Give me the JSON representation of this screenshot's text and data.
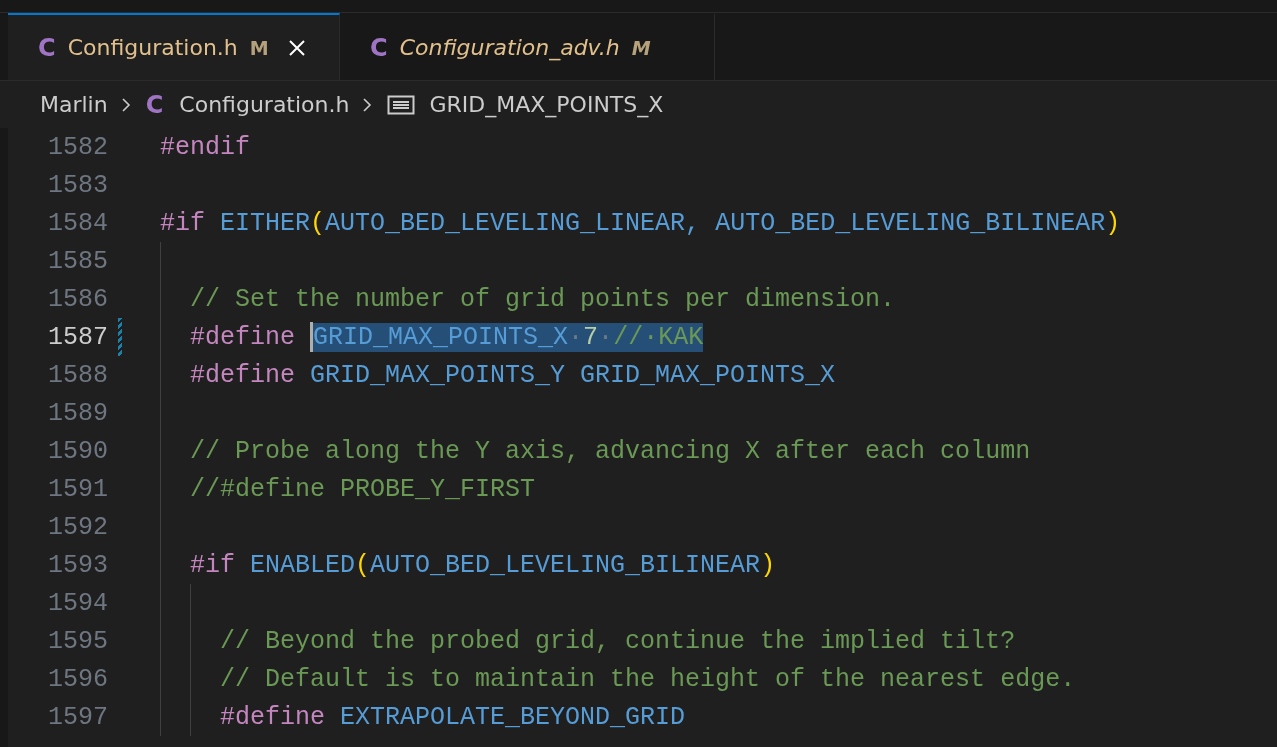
{
  "tabs": [
    {
      "icon": "C",
      "label": "Configuration.h",
      "status": "M",
      "selected": true,
      "preview": false
    },
    {
      "icon": "C",
      "label": "Configuration_adv.h",
      "status": "M",
      "selected": false,
      "preview": true
    }
  ],
  "breadcrumb": [
    {
      "kind": "folder",
      "label": "Marlin"
    },
    {
      "kind": "file",
      "icon": "C",
      "label": "Configuration.h"
    },
    {
      "kind": "symbol",
      "label": "GRID_MAX_POINTS_X"
    }
  ],
  "editor": {
    "lines": [
      {
        "number": "1582",
        "current": false,
        "modified": false,
        "tokens": [
          {
            "kind": "keyword",
            "text": "#endif"
          }
        ]
      },
      {
        "number": "1583",
        "current": false,
        "modified": false
      },
      {
        "number": "1584",
        "current": false,
        "modified": false,
        "tokens": [
          {
            "kind": "keyword",
            "text": "#if"
          },
          {
            "kind": "macro",
            "text": " EITHER"
          },
          {
            "kind": "paren",
            "text": "("
          },
          {
            "kind": "macro",
            "text": "AUTO_BED_LEVELING_LINEAR, AUTO_BED_LEVELING_BILINEAR"
          },
          {
            "kind": "paren",
            "text": ")"
          }
        ],
        "children": [
          {
            "number": "1585",
            "current": false,
            "modified": false
          },
          {
            "number": "1586",
            "current": false,
            "modified": false,
            "tokens": [
              {
                "kind": "comment",
                "text": "// Set the number of grid points per dimension."
              }
            ]
          },
          {
            "number": "1587",
            "current": true,
            "modified": true,
            "tokens": [
              {
                "kind": "keyword",
                "text": "#define "
              },
              {
                "kind": "macro",
                "text": "GRID_MAX_POINTS_X",
                "selected": true
              },
              {
                "kind": "space",
                "text": "·",
                "selected": true
              },
              {
                "kind": "number",
                "text": "7",
                "selected": true
              },
              {
                "kind": "space",
                "text": "·",
                "selected": true
              },
              {
                "kind": "comment",
                "text": "//·KAK",
                "selected": true
              }
            ]
          },
          {
            "number": "1588",
            "current": false,
            "modified": false,
            "tokens": [
              {
                "kind": "keyword",
                "text": "#define "
              },
              {
                "kind": "macro",
                "text": "GRID_MAX_POINTS_Y GRID_MAX_POINTS_X"
              }
            ]
          },
          {
            "number": "1589",
            "current": false,
            "modified": false
          },
          {
            "number": "1590",
            "current": false,
            "modified": false,
            "tokens": [
              {
                "kind": "comment",
                "text": "// Probe along the Y axis, advancing X after each column"
              }
            ]
          },
          {
            "number": "1591",
            "current": false,
            "modified": false,
            "tokens": [
              {
                "kind": "comment",
                "text": "//#define PROBE_Y_FIRST"
              }
            ]
          },
          {
            "number": "1592",
            "current": false,
            "modified": false
          },
          {
            "number": "1593",
            "current": false,
            "modified": false,
            "tokens": [
              {
                "kind": "keyword",
                "text": "#if"
              },
              {
                "kind": "macro",
                "text": " ENABLED"
              },
              {
                "kind": "paren",
                "text": "("
              },
              {
                "kind": "macro",
                "text": "AUTO_BED_LEVELING_BILINEAR"
              },
              {
                "kind": "paren",
                "text": ")"
              }
            ],
            "children": [
              {
                "number": "1594",
                "current": false,
                "modified": false
              },
              {
                "number": "1595",
                "current": false,
                "modified": false,
                "tokens": [
                  {
                    "kind": "comment",
                    "text": "// Beyond the probed grid, continue the implied tilt?"
                  }
                ]
              },
              {
                "number": "1596",
                "current": false,
                "modified": false,
                "tokens": [
                  {
                    "kind": "comment",
                    "text": "// Default is to maintain the height of the nearest edge."
                  }
                ]
              },
              {
                "number": "1597",
                "current": false,
                "modified": false,
                "tokens": [
                  {
                    "kind": "keyword",
                    "text": "#define "
                  },
                  {
                    "kind": "macro",
                    "text": "EXTRAPOLATE_BEYOND_GRID"
                  }
                ]
              }
            ]
          }
        ]
      }
    ]
  }
}
